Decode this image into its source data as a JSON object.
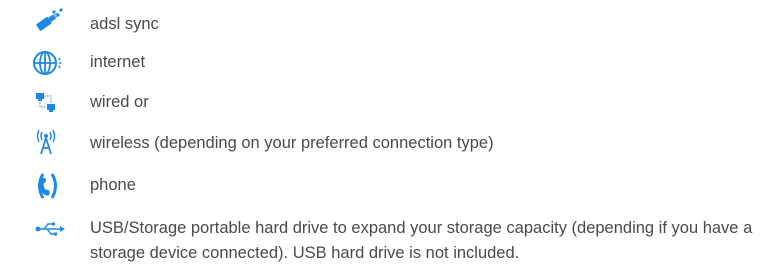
{
  "legend": {
    "items": [
      {
        "icon": "adsl-sync-icon",
        "label": "adsl sync"
      },
      {
        "icon": "internet-globe-icon",
        "label": "internet"
      },
      {
        "icon": "wired-network-icon",
        "label": "wired or"
      },
      {
        "icon": "wireless-antenna-icon",
        "label": "wireless (depending on your preferred connection type)"
      },
      {
        "icon": "phone-icon",
        "label": "phone"
      },
      {
        "icon": "usb-icon",
        "label": "USB/Storage portable hard drive to expand your storage capacity (depending if you have a storage device connected). USB hard drive is not included."
      }
    ]
  },
  "colors": {
    "accent": "#1e88e5",
    "text": "#4a4a4a"
  }
}
